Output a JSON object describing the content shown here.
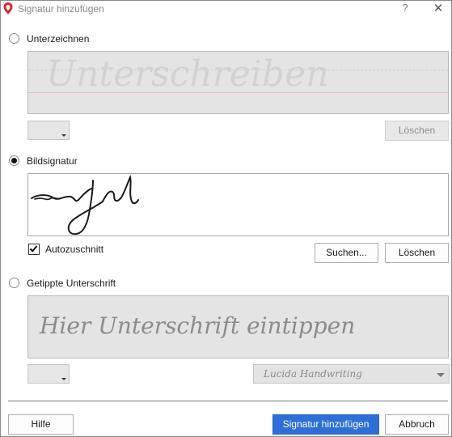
{
  "window": {
    "title": "Signatur hinzufügen",
    "help_glyph": "?",
    "close_glyph": "✕"
  },
  "options": {
    "draw": {
      "label": "Unterzeichnen",
      "selected": false,
      "placeholder": "Unterschreiben",
      "clear_label": "Löschen"
    },
    "image": {
      "label": "Bildsignatur",
      "selected": true,
      "autocrop_label": "Autozuschnitt",
      "autocrop_checked": true,
      "browse_label": "Suchen...",
      "clear_label": "Löschen"
    },
    "typed": {
      "label": "Getippte Unterschrift",
      "selected": false,
      "placeholder": "Hier Unterschrift eintippen",
      "font_value": "Lucida Handwriting"
    }
  },
  "footer": {
    "help_label": "Hilfe",
    "add_label": "Signatur hinzufügen",
    "cancel_label": "Abbruch"
  },
  "colors": {
    "accent": "#2d6fd6",
    "logo": "#d8262c"
  }
}
